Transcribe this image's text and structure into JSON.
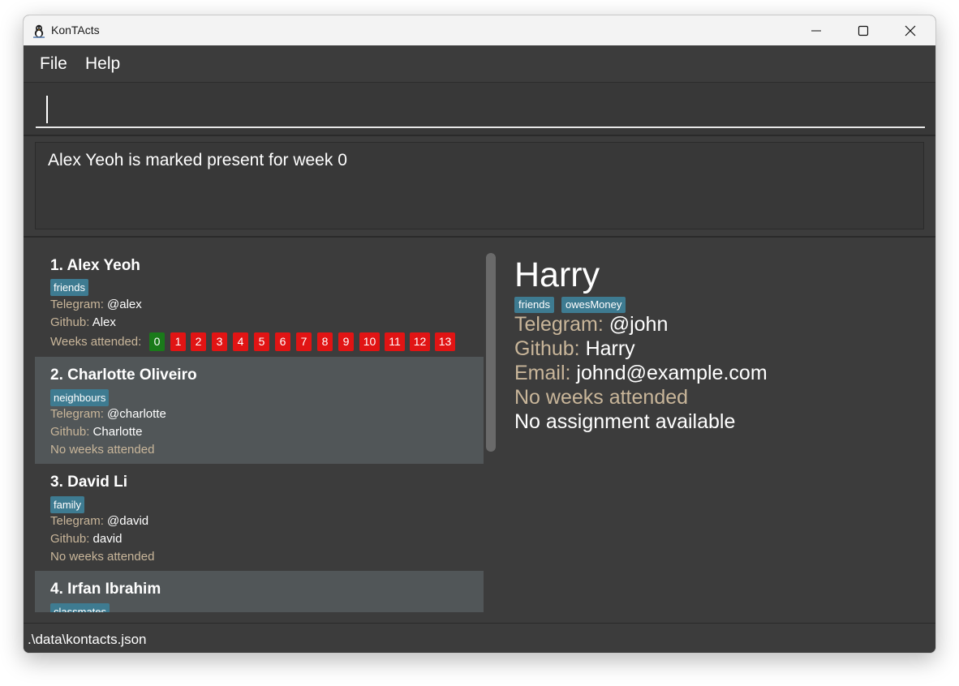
{
  "window": {
    "title": "KonTActs",
    "app_icon": "penguin-icon"
  },
  "menu": {
    "file": "File",
    "help": "Help"
  },
  "command": {
    "value": "",
    "placeholder": ""
  },
  "result": {
    "message": "Alex Yeoh is marked present for week 0"
  },
  "labels": {
    "telegram": "Telegram:",
    "github": "Github:",
    "email": "Email:",
    "weeks_attended": "Weeks attended:",
    "no_weeks": "No weeks attended",
    "no_assignment": "No assignment available"
  },
  "persons": [
    {
      "index": "1.",
      "name": "Alex Yeoh",
      "tags": [
        "friends"
      ],
      "telegram": "@alex",
      "github": "Alex",
      "weeks": [
        {
          "label": "0",
          "present": true
        },
        {
          "label": "1",
          "present": false
        },
        {
          "label": "2",
          "present": false
        },
        {
          "label": "3",
          "present": false
        },
        {
          "label": "4",
          "present": false
        },
        {
          "label": "5",
          "present": false
        },
        {
          "label": "6",
          "present": false
        },
        {
          "label": "7",
          "present": false
        },
        {
          "label": "8",
          "present": false
        },
        {
          "label": "9",
          "present": false
        },
        {
          "label": "10",
          "present": false
        },
        {
          "label": "11",
          "present": false
        },
        {
          "label": "12",
          "present": false
        },
        {
          "label": "13",
          "present": false
        }
      ]
    },
    {
      "index": "2.",
      "name": "Charlotte Oliveiro",
      "tags": [
        "neighbours"
      ],
      "telegram": "@charlotte",
      "github": "Charlotte"
    },
    {
      "index": "3.",
      "name": "David Li",
      "tags": [
        "family"
      ],
      "telegram": "@david",
      "github": "david"
    },
    {
      "index": "4.",
      "name": "Irfan Ibrahim",
      "tags": [
        "classmates"
      ]
    }
  ],
  "detail": {
    "name": "Harry",
    "tags": [
      "friends",
      "owesMoney"
    ],
    "telegram": "@john",
    "github": "Harry",
    "email": "johnd@example.com"
  },
  "status": {
    "path": ".\\data\\kontacts.json"
  },
  "colors": {
    "background": "#3c3c3c",
    "tag": "#3e7b91",
    "label": "#c9b69a",
    "week_present": "#1a7a1a",
    "week_absent": "#e11414"
  }
}
